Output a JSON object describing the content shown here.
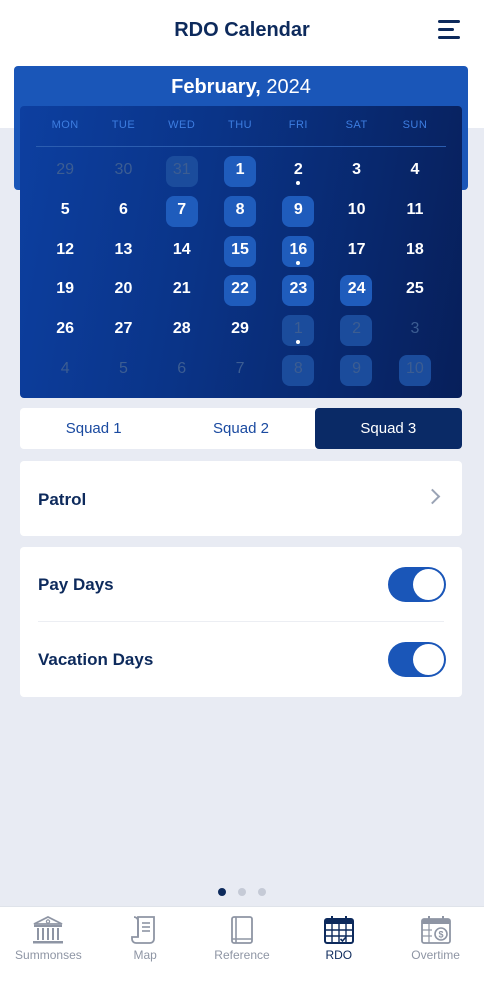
{
  "header": {
    "title": "RDO Calendar"
  },
  "calendar": {
    "month": "February,",
    "year": "2024",
    "weekdays": [
      "MON",
      "TUE",
      "WED",
      "THU",
      "FRI",
      "SAT",
      "SUN"
    ],
    "weeks": [
      [
        {
          "d": "29",
          "out": true
        },
        {
          "d": "30",
          "out": true
        },
        {
          "d": "31",
          "out": true,
          "hl": true
        },
        {
          "d": "1",
          "hl": true
        },
        {
          "d": "2",
          "dot": true
        },
        {
          "d": "3"
        },
        {
          "d": "4"
        }
      ],
      [
        {
          "d": "5"
        },
        {
          "d": "6"
        },
        {
          "d": "7",
          "hl": true
        },
        {
          "d": "8",
          "hl": true
        },
        {
          "d": "9",
          "hl": true
        },
        {
          "d": "10"
        },
        {
          "d": "11"
        }
      ],
      [
        {
          "d": "12"
        },
        {
          "d": "13"
        },
        {
          "d": "14"
        },
        {
          "d": "15",
          "hl": true
        },
        {
          "d": "16",
          "hl": true,
          "dot": true
        },
        {
          "d": "17"
        },
        {
          "d": "18"
        }
      ],
      [
        {
          "d": "19"
        },
        {
          "d": "20"
        },
        {
          "d": "21"
        },
        {
          "d": "22",
          "hl": true
        },
        {
          "d": "23",
          "hl": true
        },
        {
          "d": "24",
          "hl": true
        },
        {
          "d": "25"
        }
      ],
      [
        {
          "d": "26"
        },
        {
          "d": "27"
        },
        {
          "d": "28"
        },
        {
          "d": "29"
        },
        {
          "d": "1",
          "out": true,
          "hl": true,
          "dot": true
        },
        {
          "d": "2",
          "out": true,
          "hl": true
        },
        {
          "d": "3",
          "out": true
        }
      ],
      [
        {
          "d": "4",
          "out": true
        },
        {
          "d": "5",
          "out": true
        },
        {
          "d": "6",
          "out": true
        },
        {
          "d": "7",
          "out": true
        },
        {
          "d": "8",
          "out": true,
          "hl": true
        },
        {
          "d": "9",
          "out": true,
          "hl": true
        },
        {
          "d": "10",
          "out": true,
          "hl": true
        }
      ]
    ]
  },
  "squads": {
    "items": [
      "Squad 1",
      "Squad 2",
      "Squad 3"
    ],
    "active_index": 2
  },
  "patrol": {
    "label": "Patrol"
  },
  "toggles": [
    {
      "label": "Pay Days",
      "on": true
    },
    {
      "label": "Vacation Days",
      "on": true
    }
  ],
  "pager": {
    "pages": 3,
    "current": 0
  },
  "tabbar": {
    "items": [
      {
        "label": "Summonses",
        "icon": "courthouse-icon"
      },
      {
        "label": "Map",
        "icon": "scroll-map-icon"
      },
      {
        "label": "Reference",
        "icon": "book-icon"
      },
      {
        "label": "RDO",
        "icon": "calendar-icon"
      },
      {
        "label": "Overtime",
        "icon": "calendar-dollar-icon"
      }
    ],
    "active_index": 3
  },
  "colors": {
    "primary": "#0d2a5c",
    "accent": "#1a56b8",
    "background": "#e8ebf3",
    "inactive": "#8e95a4"
  }
}
